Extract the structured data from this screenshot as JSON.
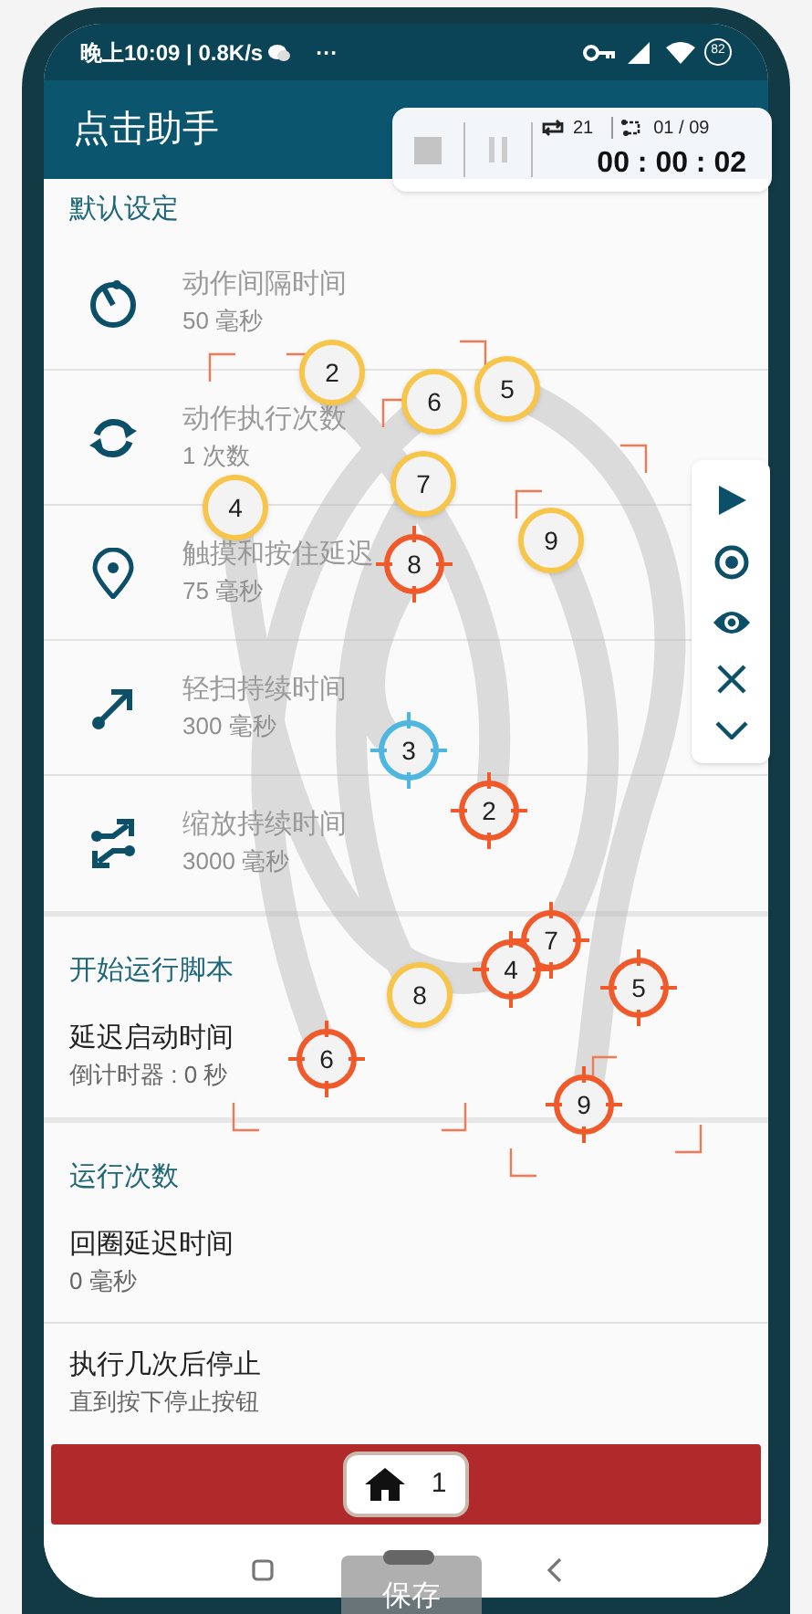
{
  "status_bar": {
    "time": "晚上10:09 | 0.8K/s",
    "more": "···",
    "battery": "82"
  },
  "app_bar": {
    "title": "点击助手"
  },
  "control_panel": {
    "loop_count": "21",
    "step": "01 / 09",
    "timer": "00 : 00 : 02"
  },
  "sections": [
    {
      "title": "默认设定",
      "items": [
        {
          "kind": "icon",
          "title": "动作间隔时间",
          "value": "50 毫秒",
          "disabled": true
        },
        {
          "kind": "icon",
          "title": "动作执行次数",
          "value": "1 次数",
          "disabled": true
        },
        {
          "kind": "icon",
          "title": "触摸和按住延迟",
          "value": "75 毫秒",
          "disabled": true
        },
        {
          "kind": "icon",
          "title": "轻扫持续时间",
          "value": "300 毫秒",
          "disabled": true
        },
        {
          "kind": "icon",
          "title": "缩放持续时间",
          "value": "3000 毫秒",
          "disabled": true
        }
      ]
    },
    {
      "title": "开始运行脚本",
      "items": [
        {
          "kind": "plain",
          "title": "延迟启动时间",
          "value": "倒计时器 : 0 秒",
          "disabled": false
        }
      ]
    },
    {
      "title": "运行次数",
      "items": [
        {
          "kind": "plain",
          "title": "回圈延迟时间",
          "value": "0 毫秒",
          "disabled": false
        },
        {
          "kind": "plain",
          "title": "执行几次后停止",
          "value": "直到按下停止按钮",
          "disabled": false
        }
      ]
    }
  ],
  "markers": [
    {
      "kind": "tap",
      "label": "2",
      "selected": false
    },
    {
      "kind": "tap",
      "label": "6",
      "selected": false
    },
    {
      "kind": "tap",
      "label": "5",
      "selected": false
    },
    {
      "kind": "tap",
      "label": "7",
      "selected": false
    },
    {
      "kind": "tap",
      "label": "4",
      "selected": false
    },
    {
      "kind": "tap",
      "label": "9",
      "selected": false
    },
    {
      "kind": "target",
      "label": "8",
      "selected": false
    },
    {
      "kind": "target",
      "label": "3",
      "selected": true
    },
    {
      "kind": "target",
      "label": "2",
      "selected": false
    },
    {
      "kind": "target",
      "label": "7",
      "selected": false
    },
    {
      "kind": "target",
      "label": "4",
      "selected": false
    },
    {
      "kind": "target",
      "label": "5",
      "selected": false
    },
    {
      "kind": "tap",
      "label": "8",
      "selected": false
    },
    {
      "kind": "target",
      "label": "6",
      "selected": false
    },
    {
      "kind": "target",
      "label": "9",
      "selected": false
    }
  ],
  "bottom_bar": {
    "home_count": "1"
  },
  "save_button": "保存"
}
